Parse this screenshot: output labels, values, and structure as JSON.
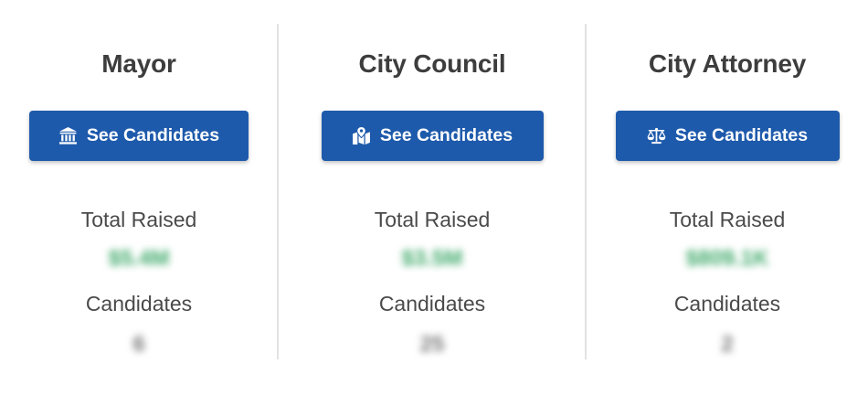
{
  "offices": [
    {
      "title": "Mayor",
      "button_label": "See Candidates",
      "icon": "building-columns-icon",
      "total_raised_label": "Total Raised",
      "total_raised": "$5.4M",
      "candidates_label": "Candidates",
      "candidates": "6"
    },
    {
      "title": "City Council",
      "button_label": "See Candidates",
      "icon": "map-location-icon",
      "total_raised_label": "Total Raised",
      "total_raised": "$3.5M",
      "candidates_label": "Candidates",
      "candidates": "25"
    },
    {
      "title": "City Attorney",
      "button_label": "See Candidates",
      "icon": "scale-balanced-icon",
      "total_raised_label": "Total Raised",
      "total_raised": "$809.1K",
      "candidates_label": "Candidates",
      "candidates": "2"
    }
  ],
  "colors": {
    "button": "#1e5aab",
    "amount": "#3fa96a",
    "text": "#3d3d3d"
  }
}
